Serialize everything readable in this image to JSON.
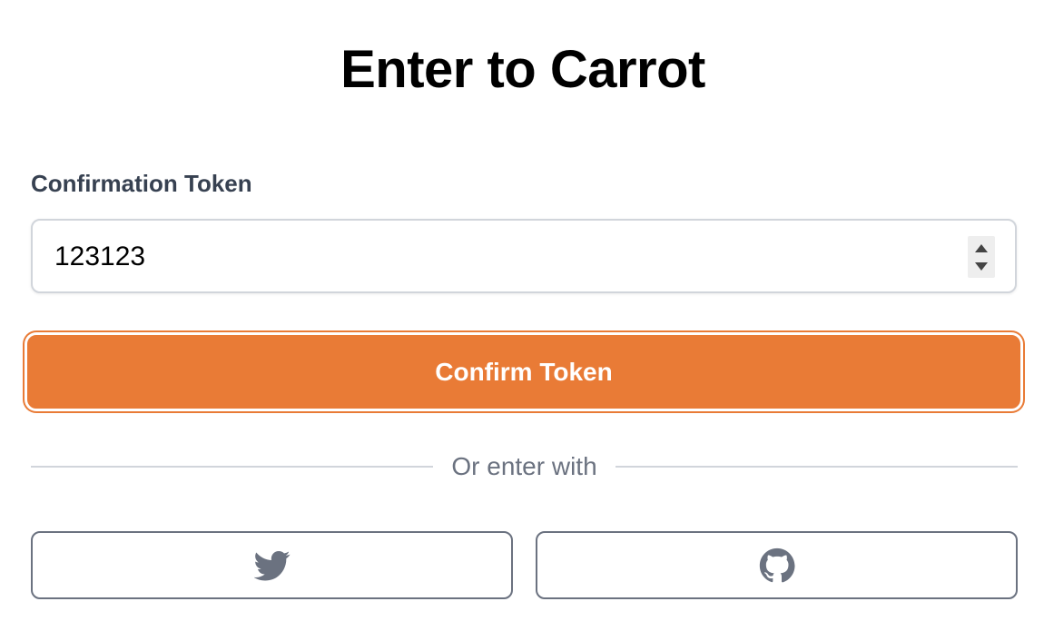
{
  "page": {
    "title": "Enter to Carrot"
  },
  "form": {
    "token_label": "Confirmation Token",
    "token_value": "123123",
    "confirm_label": "Confirm Token"
  },
  "divider": {
    "text": "Or enter with"
  },
  "social": {
    "buttons": [
      {
        "icon": "twitter-icon"
      },
      {
        "icon": "github-icon"
      }
    ]
  },
  "colors": {
    "accent": "#e97b36",
    "label": "#374151",
    "muted": "#6b7280",
    "border": "#d1d5db"
  }
}
